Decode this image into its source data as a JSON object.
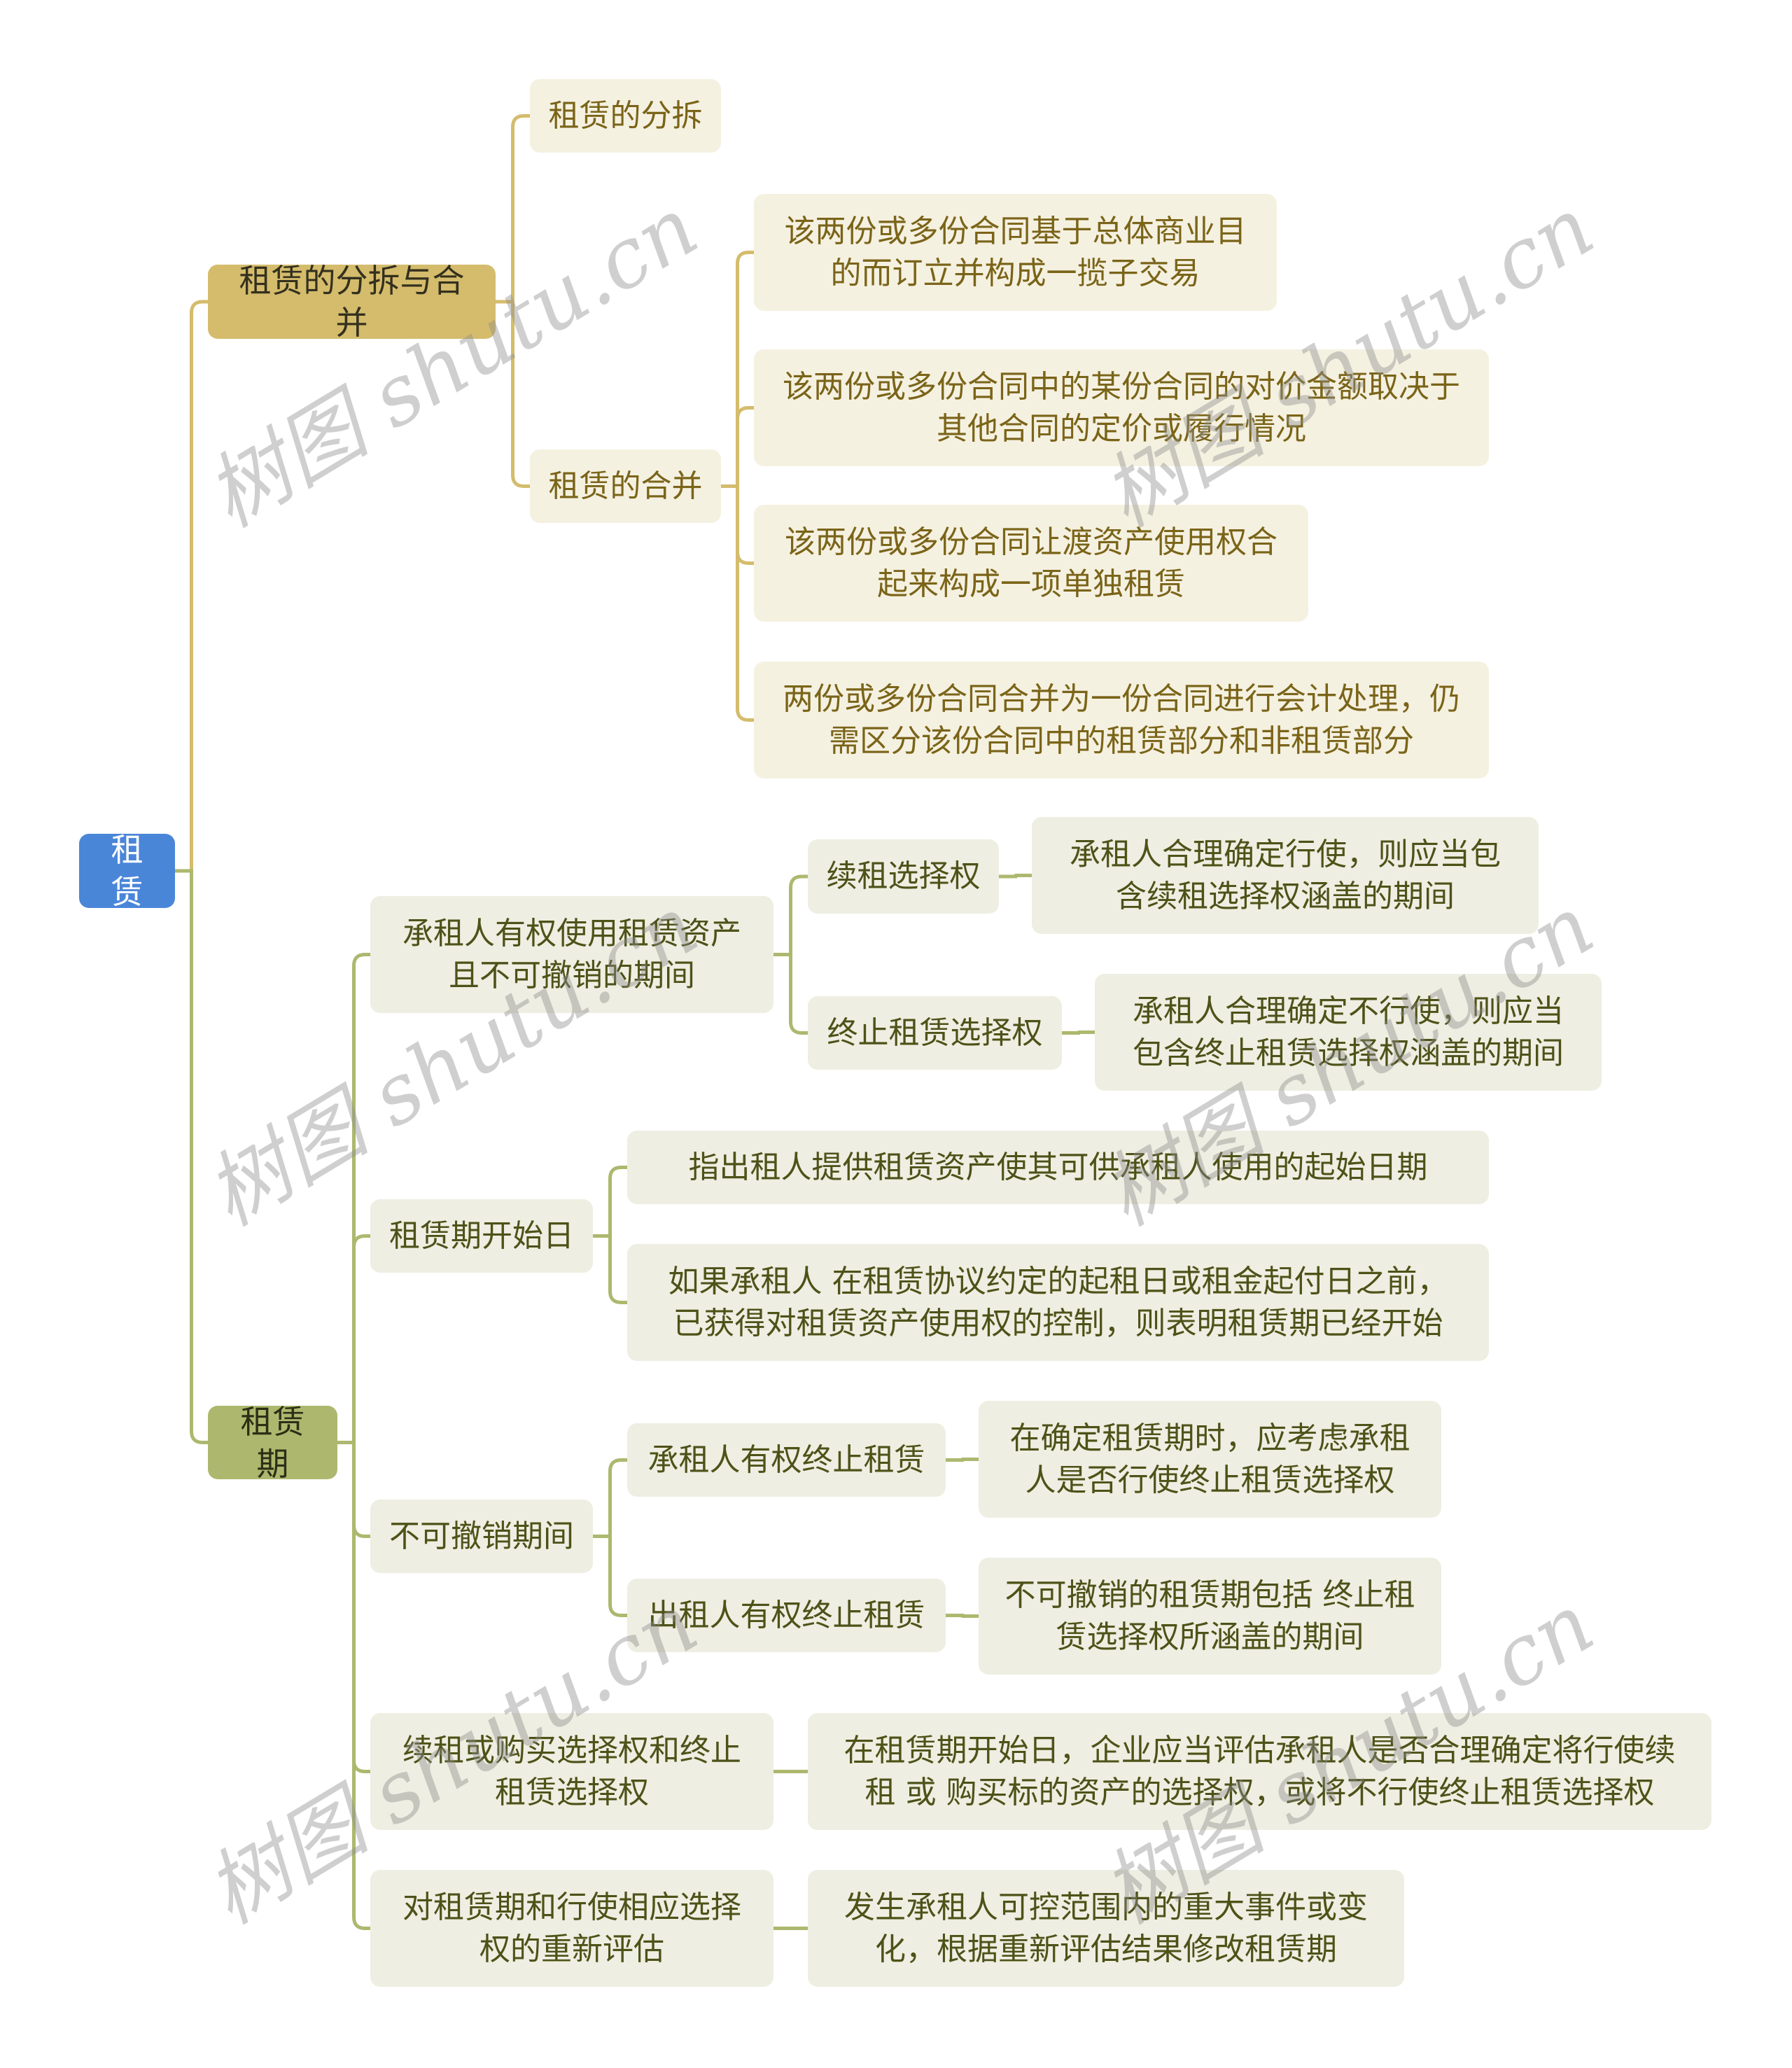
{
  "mindmap": {
    "root": {
      "id": "root",
      "label": "租赁"
    },
    "branches": [
      {
        "id": "split-merge",
        "label": "租赁的分拆与合并",
        "theme": "gold",
        "children": [
          {
            "id": "split",
            "label": "租赁的分拆",
            "children": []
          },
          {
            "id": "merge",
            "label": "租赁的合并",
            "children": [
              {
                "id": "merge-1",
                "label": "该两份或多份合同基于总体商业目\n的而订立并构成一揽子交易"
              },
              {
                "id": "merge-2",
                "label": "该两份或多份合同中的某份合同的对价金额取决于\n其他合同的定价或履行情况"
              },
              {
                "id": "merge-3",
                "label": "该两份或多份合同让渡资产使用权合\n起来构成一项单独租赁"
              },
              {
                "id": "merge-4",
                "label": "两份或多份合同合并为一份合同进行会计处理，仍\n需区分该份合同中的租赁部分和非租赁部分"
              }
            ]
          }
        ]
      },
      {
        "id": "term",
        "label": "租赁期",
        "theme": "olive",
        "children": [
          {
            "id": "noncancel-right",
            "label": "承租人有权使用租赁资产\n且不可撤销的期间",
            "children": [
              {
                "id": "renew-option",
                "label": "续租选择权",
                "children": [
                  {
                    "id": "renew-option-note",
                    "label": "承租人合理确定行使，则应当包\n含续租选择权涵盖的期间"
                  }
                ]
              },
              {
                "id": "terminate-option",
                "label": "终止租赁选择权",
                "children": [
                  {
                    "id": "terminate-option-note",
                    "label": "承租人合理确定不行使，则应当\n包含终止租赁选择权涵盖的期间"
                  }
                ]
              }
            ]
          },
          {
            "id": "start-date",
            "label": "租赁期开始日",
            "children": [
              {
                "id": "start-date-1",
                "label": "指出租人提供租赁资产使其可供承租人使用的起始日期"
              },
              {
                "id": "start-date-2",
                "label": "如果承租人 在租赁协议约定的起租日或租金起付日之前，\n已获得对租赁资产使用权的控制，则表明租赁期已经开始"
              }
            ]
          },
          {
            "id": "noncancel-period",
            "label": "不可撤销期间",
            "children": [
              {
                "id": "lessee-terminate",
                "label": "承租人有权终止租赁",
                "children": [
                  {
                    "id": "lessee-terminate-note",
                    "label": "在确定租赁期时，应考虑承租\n人是否行使终止租赁选择权"
                  }
                ]
              },
              {
                "id": "lessor-terminate",
                "label": "出租人有权终止租赁",
                "children": [
                  {
                    "id": "lessor-terminate-note",
                    "label": "不可撤销的租赁期包括 终止租\n赁选择权所涵盖的期间"
                  }
                ]
              }
            ]
          },
          {
            "id": "renew-purchase",
            "label": "续租或购买选择权和终止\n租赁选择权",
            "children": [
              {
                "id": "renew-purchase-note",
                "label": "在租赁期开始日，企业应当评估承租人是否合理确定将行使续\n租 或 购买标的资产的选择权，或将不行使终止租赁选择权"
              }
            ]
          },
          {
            "id": "reassess",
            "label": "对租赁期和行使相应选择\n权的重新评估",
            "children": [
              {
                "id": "reassess-note",
                "label": "发生承租人可控范围内的重大事件或变\n化，根据重新评估结果修改租赁期"
              }
            ]
          }
        ]
      }
    ]
  },
  "colors": {
    "root_bg": "#4a86d8",
    "gold_branch": "#d4bc6c",
    "gold_node_bg": "#f5f1e1",
    "gold_text": "#7a6418",
    "olive_branch": "#adb86e",
    "olive_node_bg": "#eeeee2",
    "olive_text": "#4d5218"
  },
  "watermark": {
    "text": "树图 shutu.cn"
  }
}
